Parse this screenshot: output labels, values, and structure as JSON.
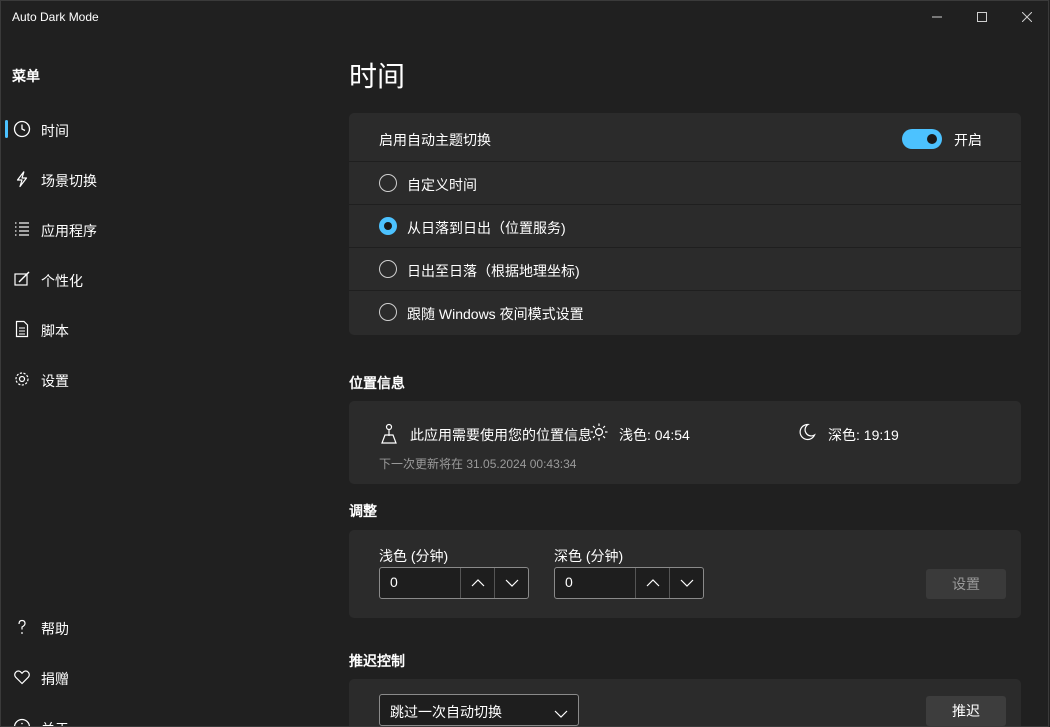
{
  "window": {
    "title": "Auto Dark Mode"
  },
  "sidebar": {
    "menu_title": "菜单",
    "items": [
      {
        "label": "时间",
        "icon": "clock-icon",
        "active": true
      },
      {
        "label": "场景切换",
        "icon": "lightning-icon"
      },
      {
        "label": "应用程序",
        "icon": "list-icon"
      },
      {
        "label": "个性化",
        "icon": "personalize-icon"
      },
      {
        "label": "脚本",
        "icon": "document-icon"
      },
      {
        "label": "设置",
        "icon": "gear-icon"
      }
    ],
    "bottom_items": [
      {
        "label": "帮助",
        "icon": "question-icon"
      },
      {
        "label": "捐赠",
        "icon": "heart-icon"
      },
      {
        "label": "关于",
        "icon": "info-icon"
      }
    ],
    "accent": "#4cc2ff"
  },
  "main": {
    "page_title": "时间",
    "auto_switch": {
      "label": "启用自动主题切换",
      "toggle_state": "开启",
      "enabled": true
    },
    "modes": [
      {
        "label": "自定义时间",
        "selected": false
      },
      {
        "label": "从日落到日出（位置服务)",
        "selected": true
      },
      {
        "label": "日出至日落（根据地理坐标)",
        "selected": false
      },
      {
        "label": "跟随 Windows 夜间模式设置",
        "selected": false
      }
    ],
    "location": {
      "section_title": "位置信息",
      "message": "此应用需要使用您的位置信息",
      "light_label": "浅色: 04:54",
      "dark_label": "深色: 19:19",
      "next_update": "下一次更新将在 31.05.2024 00:43:34"
    },
    "adjust": {
      "section_title": "调整",
      "light_label": "浅色 (分钟)",
      "light_value": "0",
      "dark_label": "深色 (分钟)",
      "dark_value": "0",
      "set_button": "设置"
    },
    "postpone": {
      "section_title": "推迟控制",
      "select_value": "跳过一次自动切换",
      "button": "推迟"
    }
  }
}
